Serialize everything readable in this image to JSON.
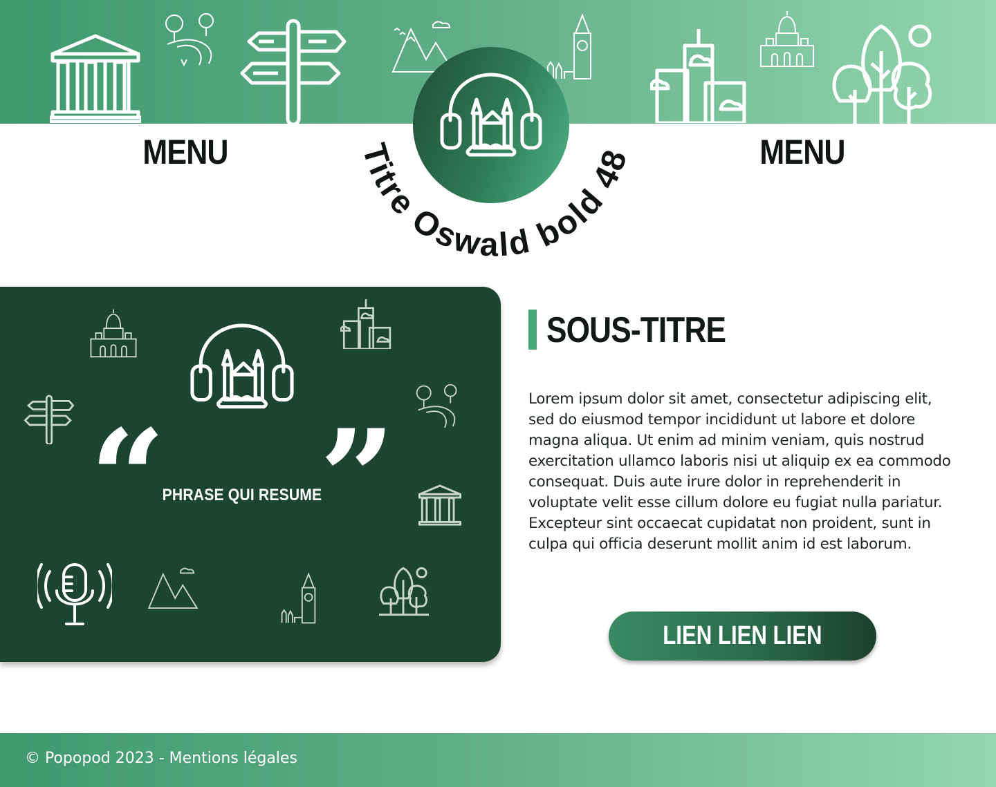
{
  "header": {
    "menu_left": "MENU",
    "menu_right": "MENU",
    "title_arc": "Titre Oswald bold 48",
    "icons": [
      "parthenon-icon",
      "park-icon",
      "signpost-icon",
      "mountains-icon",
      "big-ben-icon",
      "logo-headphones-castle-icon",
      "city-towers-icon",
      "sacre-coeur-icon",
      "trees-icon"
    ]
  },
  "panel": {
    "phrase": "PHRASE QUI RESUME",
    "open_quote": "“",
    "close_quote": "”",
    "icons": [
      "sacre-coeur-icon",
      "city-towers-icon",
      "logo-headphones-castle-icon",
      "signpost-icon",
      "park-icon",
      "parthenon-icon",
      "microphone-icon",
      "mountains-icon",
      "big-ben-icon",
      "trees-icon"
    ]
  },
  "content": {
    "subtitle": "SOUS-TITRE",
    "body": "Lorem ipsum dolor sit amet, consectetur adipiscing elit, sed do eiusmod tempor incididunt ut labore et dolore magna aliqua. Ut enim ad minim veniam, quis nostrud exercitation ullamco laboris nisi ut aliquip ex ea commodo consequat. Duis aute irure dolor in reprehenderit in voluptate velit esse cillum dolore eu fugiat nulla pariatur. Excepteur sint occaecat cupidatat non proident, sunt in culpa qui officia deserunt mollit anim id est laborum.",
    "cta_label": "LIEN LIEN LIEN"
  },
  "footer": {
    "text": "© Popopod 2023 - Mentions légales"
  },
  "colors": {
    "banner_start": "#3f9a6e",
    "banner_end": "#94d6b0",
    "panel_bg": "#1b4431",
    "accent": "#47a877",
    "text_dark": "#0f1a14"
  }
}
